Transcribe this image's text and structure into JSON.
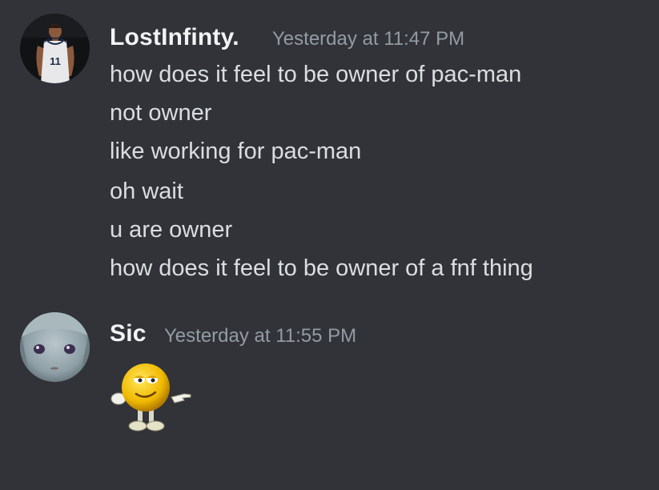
{
  "colors": {
    "background": "#313338",
    "username": "#f2f3f5",
    "timestamp": "#949ba4",
    "message_text": "#dbdee1"
  },
  "messages": [
    {
      "author": "LostInfinty.",
      "timestamp": "Yesterday at 11:47 PM",
      "avatar_icon": "basketball-player-avatar",
      "lines": [
        "how does it feel to be owner of pac-man",
        "not owner",
        "like working for pac-man",
        "oh wait",
        "u are owner",
        "how does it feel to be owner of a fnf thing"
      ]
    },
    {
      "author": "Sic",
      "timestamp": "Yesterday at 11:55 PM",
      "avatar_icon": "anime-face-avatar",
      "sticker_icon": "smiley-pointing-sticker"
    }
  ]
}
